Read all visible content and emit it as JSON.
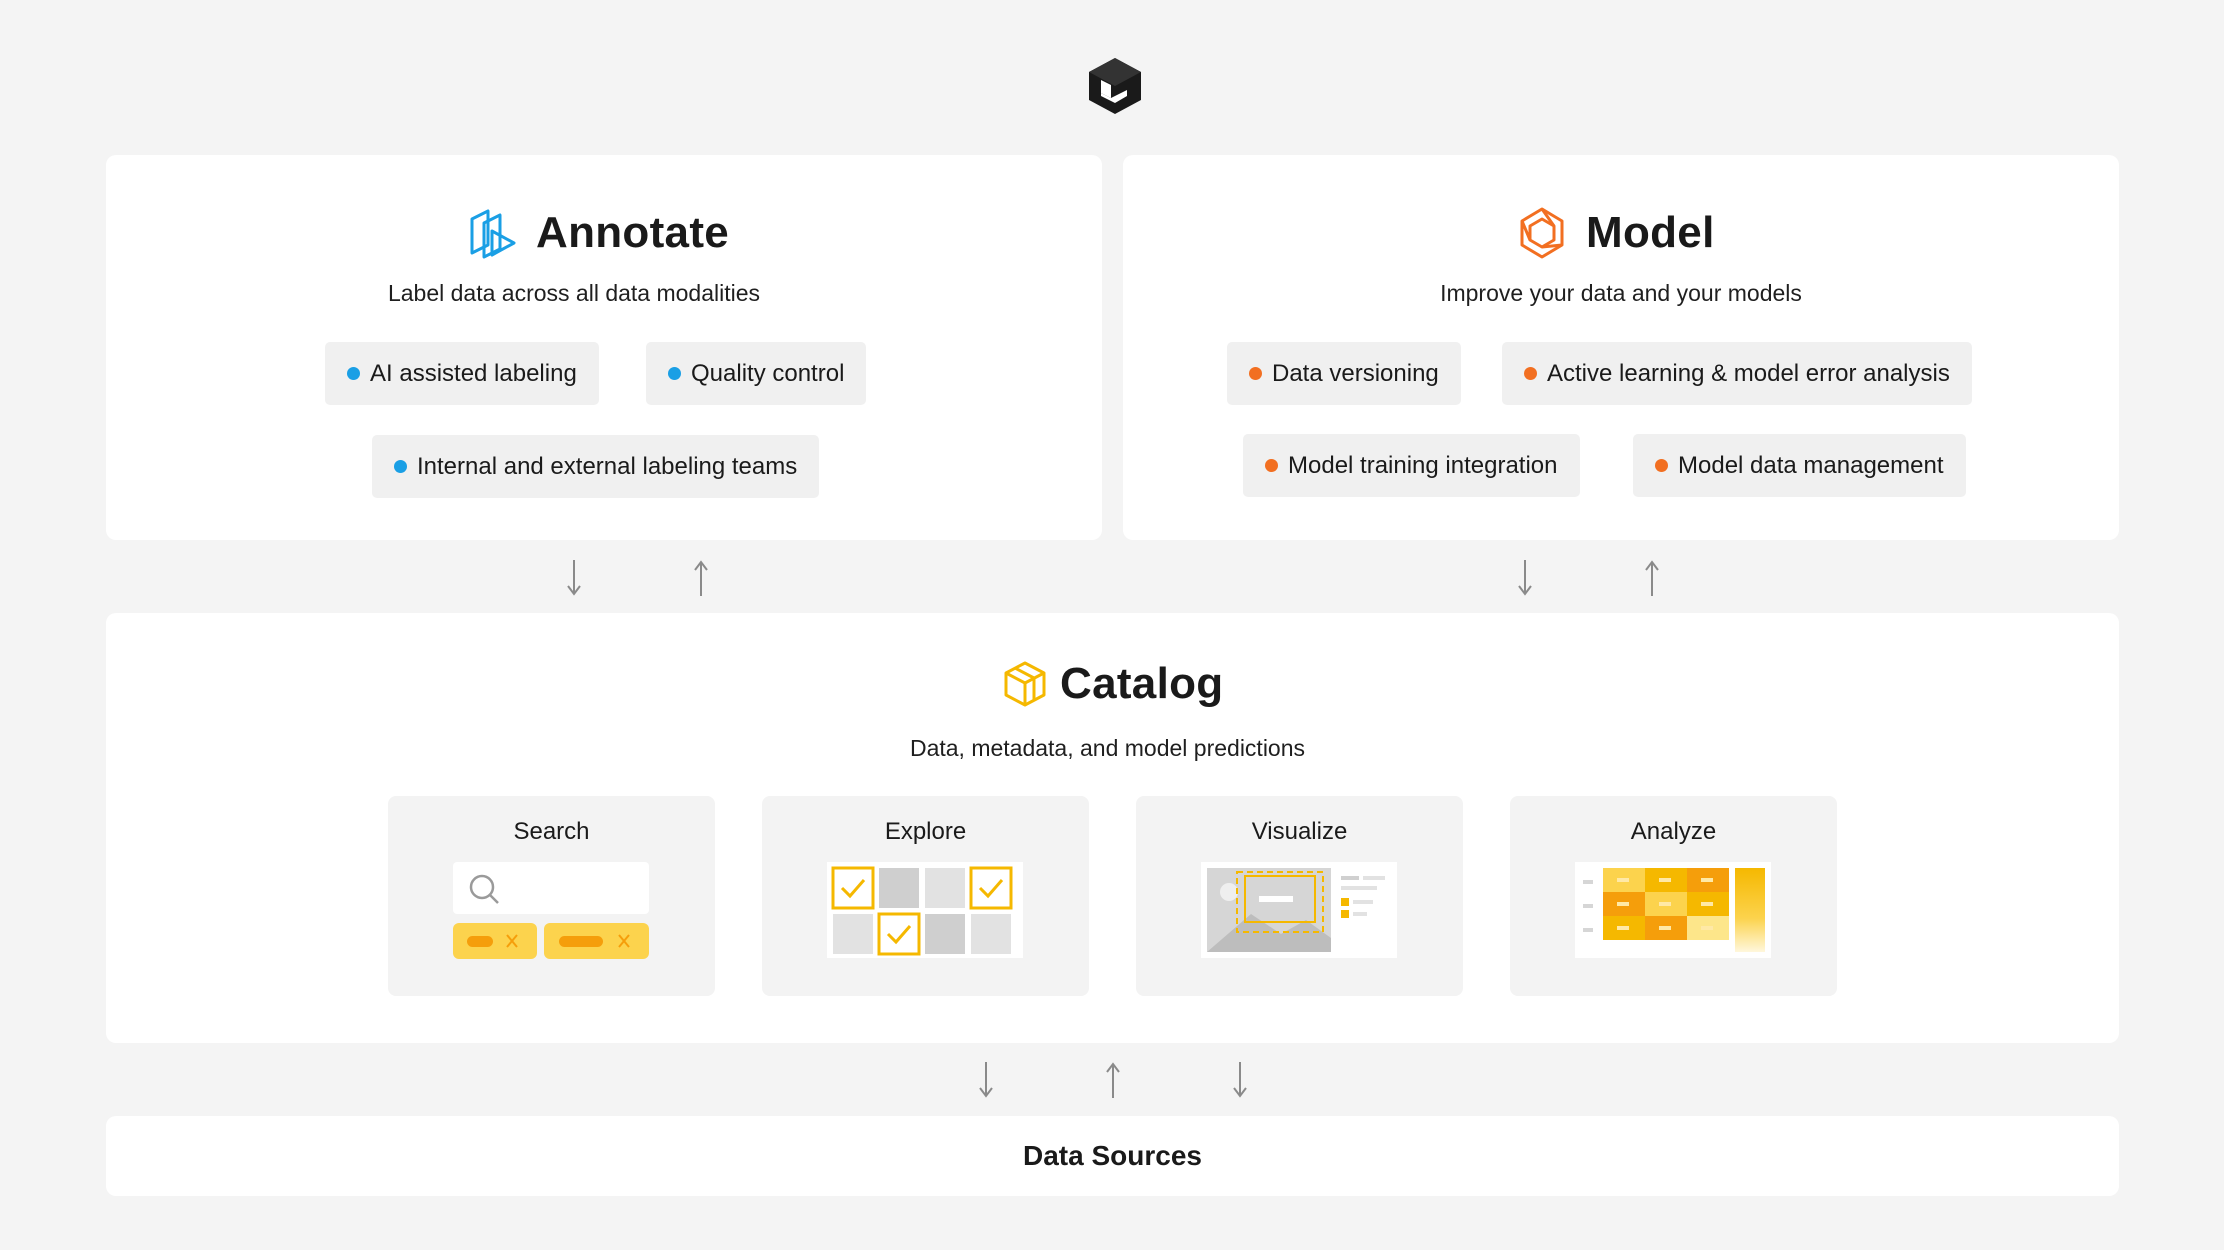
{
  "brand": {
    "logo_icon": "labelbox-cube-icon"
  },
  "annotate": {
    "title": "Annotate",
    "subtitle": "Label data across all data modalities",
    "icon": "annotate-icon",
    "accent": "#1a9fe5",
    "features": [
      "AI assisted labeling",
      "Quality control",
      "Internal and external labeling teams"
    ]
  },
  "model": {
    "title": "Model",
    "subtitle": "Improve your data and your models",
    "icon": "model-icon",
    "accent": "#f26f21",
    "features": [
      "Data versioning",
      "Active learning & model error analysis",
      "Model training integration",
      "Model data management"
    ]
  },
  "catalog": {
    "title": "Catalog",
    "subtitle": "Data, metadata, and model predictions",
    "icon": "catalog-icon",
    "accent": "#f5b800",
    "cards": [
      {
        "label": "Search",
        "icon": "search-illustration"
      },
      {
        "label": "Explore",
        "icon": "explore-grid-illustration"
      },
      {
        "label": "Visualize",
        "icon": "visualize-illustration"
      },
      {
        "label": "Analyze",
        "icon": "analyze-heatmap-illustration"
      }
    ]
  },
  "data_sources": {
    "label": "Data Sources"
  },
  "colors": {
    "background": "#f4f4f4",
    "panel": "#ffffff",
    "pill": "#f0f0f0",
    "arrow": "#8a8a8a"
  }
}
